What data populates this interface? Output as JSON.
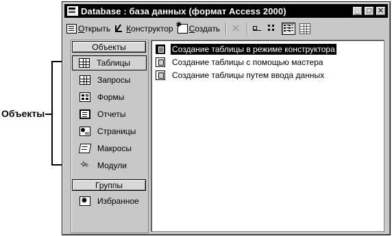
{
  "callout": {
    "label": "Объекты"
  },
  "window": {
    "title": "Database : база данных (формат Access 2000)",
    "controls": {
      "minimize": "_",
      "maximize": "□",
      "close": "✕"
    }
  },
  "toolbar": {
    "open_label": "Открыть",
    "open_hotkey": "О",
    "open_rest": "ткрыть",
    "design_label": "Конструктор",
    "design_hotkey": "К",
    "design_rest": "онструктор",
    "create_label": "Создать",
    "create_hotkey": "С",
    "create_rest": "оздать"
  },
  "objects_pane": {
    "objects_header": "Объекты",
    "items": [
      {
        "label": "Таблицы",
        "icon": "table-icon",
        "selected": true
      },
      {
        "label": "Запросы",
        "icon": "query-icon"
      },
      {
        "label": "Формы",
        "icon": "form-icon"
      },
      {
        "label": "Отчеты",
        "icon": "report-icon"
      },
      {
        "label": "Страницы",
        "icon": "page-icon"
      },
      {
        "label": "Макросы",
        "icon": "macro-icon"
      },
      {
        "label": "Модули",
        "icon": "module-icon"
      }
    ],
    "groups_header": "Группы",
    "groups": [
      {
        "label": "Избранное",
        "icon": "favorites-icon"
      }
    ]
  },
  "list": {
    "items": [
      {
        "label": "Создание таблицы в режиме конструктора",
        "selected": true
      },
      {
        "label": "Создание таблицы с помощью мастера"
      },
      {
        "label": "Создание таблицы путем ввода данных"
      }
    ]
  }
}
